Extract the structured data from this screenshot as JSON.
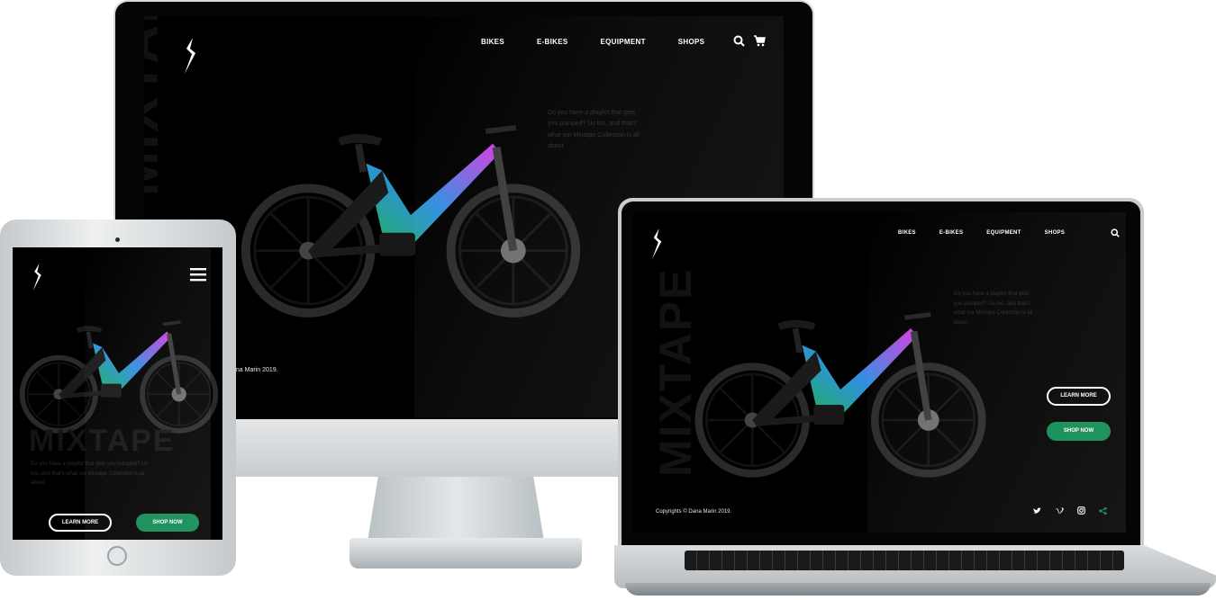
{
  "brand": {
    "accent_green": "#0e8a52",
    "bike_pink": "#d63be0",
    "bike_blue": "#2f8fe0",
    "bike_green": "#1fb060"
  },
  "site": {
    "nav": [
      "BIKES",
      "E-BIKES",
      "EQUIPMENT",
      "SHOPS"
    ],
    "hero_word": "MIXTAPE",
    "blurb": "Do you have a playlist that gets you pumped? Us too, and that's what our Mixtape Collection is all about.",
    "learn_more": "LEARN MORE",
    "shop_now": "SHOP NOW",
    "copyright": "Copyrights © Dana Marin 2019.",
    "copyright_partial": "ana Marin 2019."
  },
  "icons": {
    "logo": "specialized-logo-icon",
    "search": "search-icon",
    "cart": "cart-icon",
    "menu": "hamburger-menu-icon",
    "twitter": "twitter-icon",
    "vimeo": "vimeo-icon",
    "instagram": "instagram-icon",
    "share": "share-icon"
  }
}
